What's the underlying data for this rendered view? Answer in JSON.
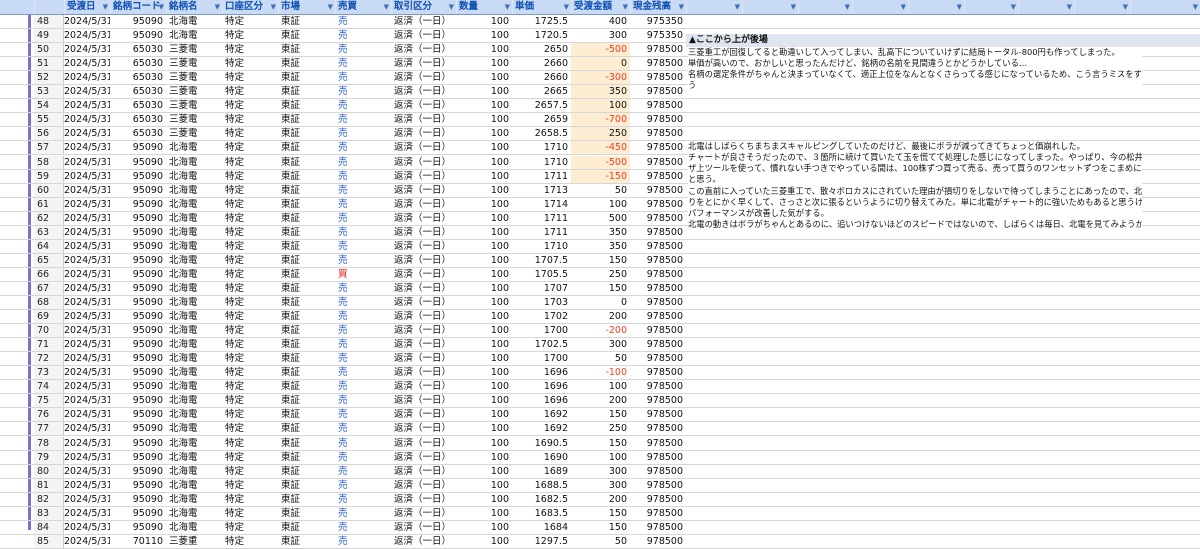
{
  "header": {
    "columns": [
      "受渡日",
      "銘柄コード",
      "銘柄名",
      "口座区分",
      "市場",
      "売買",
      "取引区分",
      "数量",
      "単価",
      "受渡金額",
      "現金残高"
    ],
    "sort_arrow": "▼"
  },
  "colors": {
    "header_bg": "#c8daf4",
    "header_text": "#0d4fb3",
    "highlight": "#fdedd3",
    "negative": "#ff3b20",
    "sell": "#1a56d6",
    "buy": "#e0201b",
    "side_bar": "#7b6fd0"
  },
  "rows": [
    {
      "n": "48",
      "date": "2024/5/31",
      "code": "95090",
      "name": "北海電",
      "acct": "特定",
      "mkt": "東証",
      "side": "売",
      "type": "返済（一日）",
      "qty": "100",
      "price": "1725.5",
      "amt": "400",
      "bal": "975350",
      "hl": false
    },
    {
      "n": "49",
      "date": "2024/5/31",
      "code": "95090",
      "name": "北海電",
      "acct": "特定",
      "mkt": "東証",
      "side": "売",
      "type": "返済（一日）",
      "qty": "100",
      "price": "1720.5",
      "amt": "300",
      "bal": "975350",
      "hl": false
    },
    {
      "n": "50",
      "date": "2024/5/31",
      "code": "65030",
      "name": "三菱電",
      "acct": "特定",
      "mkt": "東証",
      "side": "売",
      "type": "返済（一日）",
      "qty": "100",
      "price": "2650",
      "amt": "-500",
      "bal": "978500",
      "hl": true
    },
    {
      "n": "51",
      "date": "2024/5/31",
      "code": "65030",
      "name": "三菱電",
      "acct": "特定",
      "mkt": "東証",
      "side": "売",
      "type": "返済（一日）",
      "qty": "100",
      "price": "2660",
      "amt": "0",
      "bal": "978500",
      "hl": true
    },
    {
      "n": "52",
      "date": "2024/5/31",
      "code": "65030",
      "name": "三菱電",
      "acct": "特定",
      "mkt": "東証",
      "side": "売",
      "type": "返済（一日）",
      "qty": "100",
      "price": "2660",
      "amt": "-300",
      "bal": "978500",
      "hl": true
    },
    {
      "n": "53",
      "date": "2024/5/31",
      "code": "65030",
      "name": "三菱電",
      "acct": "特定",
      "mkt": "東証",
      "side": "売",
      "type": "返済（一日）",
      "qty": "100",
      "price": "2665",
      "amt": "350",
      "bal": "978500",
      "hl": true
    },
    {
      "n": "54",
      "date": "2024/5/31",
      "code": "65030",
      "name": "三菱電",
      "acct": "特定",
      "mkt": "東証",
      "side": "売",
      "type": "返済（一日）",
      "qty": "100",
      "price": "2657.5",
      "amt": "100",
      "bal": "978500",
      "hl": true
    },
    {
      "n": "55",
      "date": "2024/5/31",
      "code": "65030",
      "name": "三菱電",
      "acct": "特定",
      "mkt": "東証",
      "side": "売",
      "type": "返済（一日）",
      "qty": "100",
      "price": "2659",
      "amt": "-700",
      "bal": "978500",
      "hl": true
    },
    {
      "n": "56",
      "date": "2024/5/31",
      "code": "65030",
      "name": "三菱電",
      "acct": "特定",
      "mkt": "東証",
      "side": "売",
      "type": "返済（一日）",
      "qty": "100",
      "price": "2658.5",
      "amt": "250",
      "bal": "978500",
      "hl": true
    },
    {
      "n": "57",
      "date": "2024/5/31",
      "code": "95090",
      "name": "北海電",
      "acct": "特定",
      "mkt": "東証",
      "side": "売",
      "type": "返済（一日）",
      "qty": "100",
      "price": "1710",
      "amt": "-450",
      "bal": "978500",
      "hl": true
    },
    {
      "n": "58",
      "date": "2024/5/31",
      "code": "95090",
      "name": "北海電",
      "acct": "特定",
      "mkt": "東証",
      "side": "売",
      "type": "返済（一日）",
      "qty": "100",
      "price": "1710",
      "amt": "-500",
      "bal": "978500",
      "hl": true
    },
    {
      "n": "59",
      "date": "2024/5/31",
      "code": "95090",
      "name": "北海電",
      "acct": "特定",
      "mkt": "東証",
      "side": "売",
      "type": "返済（一日）",
      "qty": "100",
      "price": "1711",
      "amt": "-150",
      "bal": "978500",
      "hl": true
    },
    {
      "n": "60",
      "date": "2024/5/31",
      "code": "95090",
      "name": "北海電",
      "acct": "特定",
      "mkt": "東証",
      "side": "売",
      "type": "返済（一日）",
      "qty": "100",
      "price": "1713",
      "amt": "50",
      "bal": "978500",
      "hl": false
    },
    {
      "n": "61",
      "date": "2024/5/31",
      "code": "95090",
      "name": "北海電",
      "acct": "特定",
      "mkt": "東証",
      "side": "売",
      "type": "返済（一日）",
      "qty": "100",
      "price": "1714",
      "amt": "100",
      "bal": "978500",
      "hl": false
    },
    {
      "n": "62",
      "date": "2024/5/31",
      "code": "95090",
      "name": "北海電",
      "acct": "特定",
      "mkt": "東証",
      "side": "売",
      "type": "返済（一日）",
      "qty": "100",
      "price": "1711",
      "amt": "500",
      "bal": "978500",
      "hl": false
    },
    {
      "n": "63",
      "date": "2024/5/31",
      "code": "95090",
      "name": "北海電",
      "acct": "特定",
      "mkt": "東証",
      "side": "売",
      "type": "返済（一日）",
      "qty": "100",
      "price": "1711",
      "amt": "350",
      "bal": "978500",
      "hl": false
    },
    {
      "n": "64",
      "date": "2024/5/31",
      "code": "95090",
      "name": "北海電",
      "acct": "特定",
      "mkt": "東証",
      "side": "売",
      "type": "返済（一日）",
      "qty": "100",
      "price": "1710",
      "amt": "350",
      "bal": "978500",
      "hl": false
    },
    {
      "n": "65",
      "date": "2024/5/31",
      "code": "95090",
      "name": "北海電",
      "acct": "特定",
      "mkt": "東証",
      "side": "売",
      "type": "返済（一日）",
      "qty": "100",
      "price": "1707.5",
      "amt": "150",
      "bal": "978500",
      "hl": false
    },
    {
      "n": "66",
      "date": "2024/5/31",
      "code": "95090",
      "name": "北海電",
      "acct": "特定",
      "mkt": "東証",
      "side": "買",
      "type": "返済（一日）",
      "qty": "100",
      "price": "1705.5",
      "amt": "250",
      "bal": "978500",
      "hl": false
    },
    {
      "n": "67",
      "date": "2024/5/31",
      "code": "95090",
      "name": "北海電",
      "acct": "特定",
      "mkt": "東証",
      "side": "売",
      "type": "返済（一日）",
      "qty": "100",
      "price": "1707",
      "amt": "150",
      "bal": "978500",
      "hl": false
    },
    {
      "n": "68",
      "date": "2024/5/31",
      "code": "95090",
      "name": "北海電",
      "acct": "特定",
      "mkt": "東証",
      "side": "売",
      "type": "返済（一日）",
      "qty": "100",
      "price": "1703",
      "amt": "0",
      "bal": "978500",
      "hl": false
    },
    {
      "n": "69",
      "date": "2024/5/31",
      "code": "95090",
      "name": "北海電",
      "acct": "特定",
      "mkt": "東証",
      "side": "売",
      "type": "返済（一日）",
      "qty": "100",
      "price": "1702",
      "amt": "200",
      "bal": "978500",
      "hl": false
    },
    {
      "n": "70",
      "date": "2024/5/31",
      "code": "95090",
      "name": "北海電",
      "acct": "特定",
      "mkt": "東証",
      "side": "売",
      "type": "返済（一日）",
      "qty": "100",
      "price": "1700",
      "amt": "-200",
      "bal": "978500",
      "hl": false
    },
    {
      "n": "71",
      "date": "2024/5/31",
      "code": "95090",
      "name": "北海電",
      "acct": "特定",
      "mkt": "東証",
      "side": "売",
      "type": "返済（一日）",
      "qty": "100",
      "price": "1702.5",
      "amt": "300",
      "bal": "978500",
      "hl": false
    },
    {
      "n": "72",
      "date": "2024/5/31",
      "code": "95090",
      "name": "北海電",
      "acct": "特定",
      "mkt": "東証",
      "side": "売",
      "type": "返済（一日）",
      "qty": "100",
      "price": "1700",
      "amt": "50",
      "bal": "978500",
      "hl": false
    },
    {
      "n": "73",
      "date": "2024/5/31",
      "code": "95090",
      "name": "北海電",
      "acct": "特定",
      "mkt": "東証",
      "side": "売",
      "type": "返済（一日）",
      "qty": "100",
      "price": "1696",
      "amt": "-100",
      "bal": "978500",
      "hl": false
    },
    {
      "n": "74",
      "date": "2024/5/31",
      "code": "95090",
      "name": "北海電",
      "acct": "特定",
      "mkt": "東証",
      "side": "売",
      "type": "返済（一日）",
      "qty": "100",
      "price": "1696",
      "amt": "100",
      "bal": "978500",
      "hl": false
    },
    {
      "n": "75",
      "date": "2024/5/31",
      "code": "95090",
      "name": "北海電",
      "acct": "特定",
      "mkt": "東証",
      "side": "売",
      "type": "返済（一日）",
      "qty": "100",
      "price": "1696",
      "amt": "200",
      "bal": "978500",
      "hl": false
    },
    {
      "n": "76",
      "date": "2024/5/31",
      "code": "95090",
      "name": "北海電",
      "acct": "特定",
      "mkt": "東証",
      "side": "売",
      "type": "返済（一日）",
      "qty": "100",
      "price": "1692",
      "amt": "150",
      "bal": "978500",
      "hl": false
    },
    {
      "n": "77",
      "date": "2024/5/31",
      "code": "95090",
      "name": "北海電",
      "acct": "特定",
      "mkt": "東証",
      "side": "売",
      "type": "返済（一日）",
      "qty": "100",
      "price": "1692",
      "amt": "250",
      "bal": "978500",
      "hl": false
    },
    {
      "n": "78",
      "date": "2024/5/31",
      "code": "95090",
      "name": "北海電",
      "acct": "特定",
      "mkt": "東証",
      "side": "売",
      "type": "返済（一日）",
      "qty": "100",
      "price": "1690.5",
      "amt": "150",
      "bal": "978500",
      "hl": false
    },
    {
      "n": "79",
      "date": "2024/5/31",
      "code": "95090",
      "name": "北海電",
      "acct": "特定",
      "mkt": "東証",
      "side": "売",
      "type": "返済（一日）",
      "qty": "100",
      "price": "1690",
      "amt": "100",
      "bal": "978500",
      "hl": false
    },
    {
      "n": "80",
      "date": "2024/5/31",
      "code": "95090",
      "name": "北海電",
      "acct": "特定",
      "mkt": "東証",
      "side": "売",
      "type": "返済（一日）",
      "qty": "100",
      "price": "1689",
      "amt": "300",
      "bal": "978500",
      "hl": false
    },
    {
      "n": "81",
      "date": "2024/5/31",
      "code": "95090",
      "name": "北海電",
      "acct": "特定",
      "mkt": "東証",
      "side": "売",
      "type": "返済（一日）",
      "qty": "100",
      "price": "1688.5",
      "amt": "300",
      "bal": "978500",
      "hl": false
    },
    {
      "n": "82",
      "date": "2024/5/31",
      "code": "95090",
      "name": "北海電",
      "acct": "特定",
      "mkt": "東証",
      "side": "売",
      "type": "返済（一日）",
      "qty": "100",
      "price": "1682.5",
      "amt": "200",
      "bal": "978500",
      "hl": false
    },
    {
      "n": "83",
      "date": "2024/5/31",
      "code": "95090",
      "name": "北海電",
      "acct": "特定",
      "mkt": "東証",
      "side": "売",
      "type": "返済（一日）",
      "qty": "100",
      "price": "1683.5",
      "amt": "150",
      "bal": "978500",
      "hl": false
    },
    {
      "n": "84",
      "date": "2024/5/31",
      "code": "95090",
      "name": "北海電",
      "acct": "特定",
      "mkt": "東証",
      "side": "売",
      "type": "返済（一日）",
      "qty": "100",
      "price": "1684",
      "amt": "150",
      "bal": "978500",
      "hl": false
    },
    {
      "n": "85",
      "date": "2024/5/31",
      "code": "70110",
      "name": "三菱重",
      "acct": "特定",
      "mkt": "東証",
      "side": "売",
      "type": "返済（一日）",
      "qty": "100",
      "price": "1297.5",
      "amt": "50",
      "bal": "978500",
      "hl": false
    }
  ],
  "notes": {
    "heading": "▲ここから上が後場",
    "block1": [
      "三菱重工が回復してると勘違いして入ってしまい、乱高下についていけずに結局トータル-800円も作ってしまった。",
      "単価が高いので、おかしいと思ったんだけど、銘柄の名前を見間違うとかどうかしている…",
      "名柄の選定条件がちゃんと決まっていなくて、適正上位をなんとなくさらってる感じになっているため、こう言うミスをするんだと思",
      "う"
    ],
    "block2": [
      "北電はしばらくちまちまスキャルピングしていたのだけど、最後にボラが減ってきてちょっと価崩れした。",
      "チャートが良さそうだったので、３箇所に続けて買いたて玉を慌てて処理した感じになってしまった。やっぱり、今の松井のブラウ",
      "ザ上ツールを使って、慣れない手つきでやっている間は、100株ずつ買って売る、売って買うのワンセットずつをこまめに取引しよう",
      "と思う。"
    ],
    "block3": [
      "この直前に入っていた三菱重工で、散々ボロカスにされていた理由が損切りをしないで待ってしまうことにあったので、北電では損切",
      "りをとにかく早くして、さっさと次に張るというように切り替えてみた。単に北電がチャート的に強いためもあると思うけど、だいぶ",
      "パフォーマンスが改善した気がする。",
      "北電の動きはボラがちゃんとあるのに、追いつけないほどのスピードではないので、しばらくは毎日、北電を見てみようかなと思う。"
    ]
  }
}
